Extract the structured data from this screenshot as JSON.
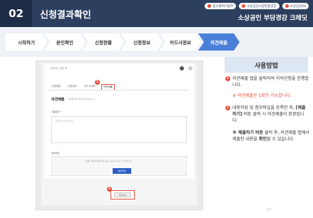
{
  "header": {
    "number": "02",
    "title": "신청결과확인",
    "logos": [
      "중소벤처기업부",
      "소상공인시장진흥공단",
      "소상공인24"
    ],
    "tagline": "소상공인 부담경감 크레딧"
  },
  "steps": [
    {
      "label": "시작하기"
    },
    {
      "label": "본인확인"
    },
    {
      "label": "신청현황"
    },
    {
      "label": "신청정보"
    },
    {
      "label": "카드사정보"
    },
    {
      "label": "의견제출"
    }
  ],
  "panel": {
    "breadcrumb": "신청내 / 신청 내",
    "tabs": [
      "신청현황",
      "신청정보",
      "카드사정보",
      "의견제출"
    ],
    "section_title": "의견제출",
    "section_sub": "의견제출을 제출하여 주십시오.",
    "field_label": "내용입력 *",
    "textarea_placeholder": "내용을 입력해주세요.",
    "attach_label": "첨부파일",
    "drop_text": "등록 가능한 확장자는 jpg, jpeg, png, pdf 입니다.",
    "upload_button": "첨부파일",
    "submit_button": "제출하기",
    "marker1": "1",
    "marker2": "2"
  },
  "usage": {
    "title": "사용방법",
    "item1_num": "1",
    "item1_text": "의견제출 탭을 클릭하여 이의신청을 진행합니다.",
    "item1_note": "※ 의견제출은 1회만 가능합니다.",
    "item2_num": "2",
    "item2_text_a": "내용작성 및 첨부파일을 등록한 후,",
    "item2_bold": "[제출하기]",
    "item2_text_b": "버튼 클릭 시 의견제출이 완료됩니다.",
    "item3_bold_a": "※ 제출하기 버튼",
    "item3_text_a": "클릭 후, 의견제출 탭에서 제출한 내용을",
    "item3_bold_b": "확인",
    "item3_text_b": "할 수 있습니다."
  },
  "page_number": "2/7"
}
